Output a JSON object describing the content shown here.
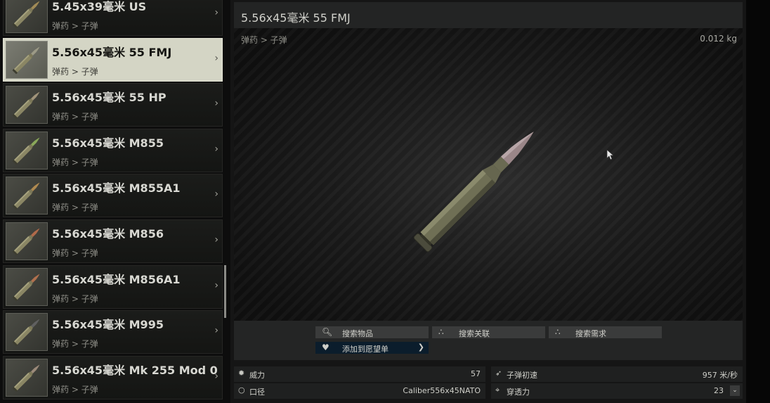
{
  "list": {
    "items": [
      {
        "name": "5.45x39毫米 US",
        "sub": "弹药 > 子弹",
        "selected": false,
        "tip": "#a08a56"
      },
      {
        "name": "5.56x45毫米 55 FMJ",
        "sub": "弹药 > 子弹",
        "selected": true,
        "tip": "#9c9a86"
      },
      {
        "name": "5.56x45毫米 55 HP",
        "sub": "弹药 > 子弹",
        "selected": false,
        "tip": "#a0937a"
      },
      {
        "name": "5.56x45毫米 M855",
        "sub": "弹药 > 子弹",
        "selected": false,
        "tip": "#8aa85a"
      },
      {
        "name": "5.56x45毫米 M855A1",
        "sub": "弹药 > 子弹",
        "selected": false,
        "tip": "#b08a50"
      },
      {
        "name": "5.56x45毫米 M856",
        "sub": "弹药 > 子弹",
        "selected": false,
        "tip": "#b06a4a"
      },
      {
        "name": "5.56x45毫米 M856A1",
        "sub": "弹药 > 子弹",
        "selected": false,
        "tip": "#b0704e"
      },
      {
        "name": "5.56x45毫米 M995",
        "sub": "弹药 > 子弹",
        "selected": false,
        "tip": "#606060"
      },
      {
        "name": "5.56x45毫米 Mk 255 Mod 0",
        "sub": "弹药 > 子弹",
        "selected": false,
        "tip": "#9c8a7a"
      }
    ]
  },
  "detail": {
    "title": "5.56x45毫米 55 FMJ",
    "category": "弹药 > 子弹",
    "weight": "0.012 kg"
  },
  "actions": {
    "search_item": "搜索物品",
    "search_related": "搜索关联",
    "search_required": "搜索需求",
    "add_wishlist": "添加到愿望单"
  },
  "stats": {
    "damage_label": "威力",
    "damage_value": "57",
    "velocity_label": "子弹初速",
    "velocity_value": "957 米/秒",
    "caliber_label": "口径",
    "caliber_value": "Caliber556x45NATO",
    "penetration_label": "穿透力",
    "penetration_value": "23"
  },
  "icons": {
    "search": "magnifier",
    "related": "nodes",
    "required": "nodes",
    "wishlist": "heart",
    "damage": "burst",
    "velocity": "bullet",
    "caliber": "ring",
    "penetration": "crosshair"
  },
  "colors": {
    "casing": "#6f6f55",
    "bullet_tip": "#9a8688",
    "selected_bg": "#d4d5c5"
  }
}
